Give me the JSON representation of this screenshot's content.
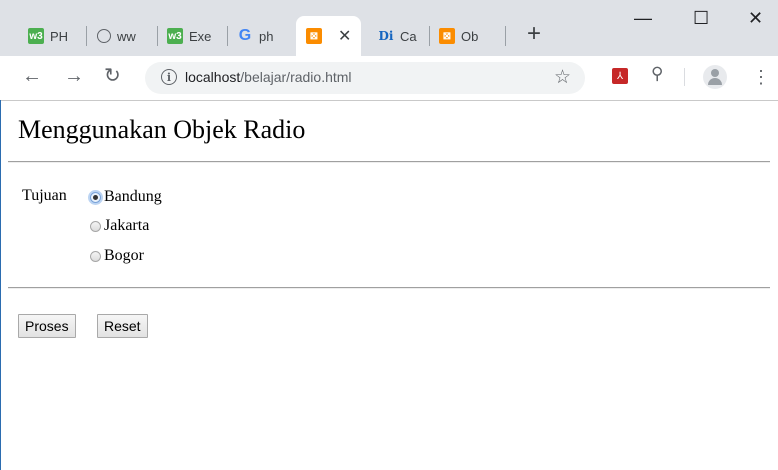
{
  "browser": {
    "tabs": [
      {
        "label": "PH",
        "icon": "w3-icon"
      },
      {
        "label": "ww",
        "icon": "globe-icon"
      },
      {
        "label": "Exe",
        "icon": "w3-icon"
      },
      {
        "label": "ph",
        "icon": "google-icon"
      },
      {
        "label": "",
        "icon": "xampp-icon",
        "active": true
      },
      {
        "label": "Ca",
        "icon": "di-icon"
      },
      {
        "label": "Ob",
        "icon": "xampp-icon"
      }
    ],
    "new_tab": "+",
    "window_controls": {
      "minimize": "—",
      "maximize": "☐",
      "close": "✕"
    },
    "url_host": "localhost",
    "url_path": "/belajar/radio.html"
  },
  "page": {
    "title": "Menggunakan Objek Radio",
    "field_label": "Tujuan",
    "options": [
      {
        "label": "Bandung",
        "checked": true
      },
      {
        "label": "Jakarta",
        "checked": false
      },
      {
        "label": "Bogor",
        "checked": false
      }
    ],
    "buttons": {
      "submit": "Proses",
      "reset": "Reset"
    }
  },
  "colors": {
    "tabbar": "#dee1e6",
    "omnibox": "#f1f3f4",
    "radio_focus": "#7aa3d8"
  }
}
